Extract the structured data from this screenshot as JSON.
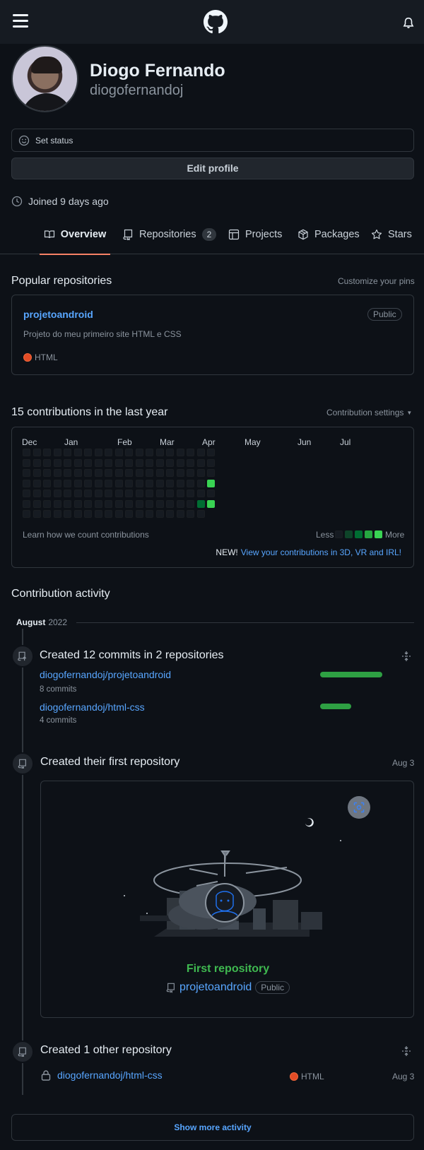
{
  "profile": {
    "full_name": "Diogo Fernando",
    "login": "diogofernandoj",
    "set_status": "Set status",
    "edit_profile": "Edit profile",
    "joined": "Joined 9 days ago"
  },
  "tabs": [
    {
      "label": "Overview",
      "icon": "book-icon",
      "active": true
    },
    {
      "label": "Repositories",
      "icon": "repo-icon",
      "count": "2"
    },
    {
      "label": "Projects",
      "icon": "table-icon"
    },
    {
      "label": "Packages",
      "icon": "package-icon"
    },
    {
      "label": "Stars",
      "icon": "star-icon"
    }
  ],
  "popular": {
    "title": "Popular repositories",
    "customize": "Customize your pins",
    "repo": {
      "name": "projetoandroid",
      "visibility": "Public",
      "description": "Projeto do meu primeiro site HTML e CSS",
      "language": "HTML",
      "language_color": "#e34c26"
    }
  },
  "contributions": {
    "title": "15 contributions in the last year",
    "settings": "Contribution settings",
    "months": [
      "Dec",
      "Jan",
      "Feb",
      "Mar",
      "Apr",
      "May",
      "Jun",
      "Jul"
    ],
    "learn": "Learn how we count contributions",
    "less": "Less",
    "more": "More",
    "new_label": "NEW!",
    "new_link": "View your contributions in 3D, VR and IRL!",
    "active_days": [
      {
        "week": 18,
        "day": 3,
        "level": 4
      },
      {
        "week": 17,
        "day": 5,
        "level": 2
      },
      {
        "week": 18,
        "day": 5,
        "level": 4
      }
    ]
  },
  "activity": {
    "title": "Contribution activity",
    "month": "August",
    "year": "2022",
    "commits": {
      "title": "Created 12 commits in 2 repositories",
      "repos": [
        {
          "name": "diogofernandoj/projetoandroid",
          "commits": "8 commits",
          "share": 1.0
        },
        {
          "name": "diogofernandoj/html-css",
          "commits": "4 commits",
          "share": 0.5
        }
      ]
    },
    "first_repo": {
      "title": "Created their first repository",
      "date": "Aug 3",
      "caption": "First repository",
      "repo": "projetoandroid",
      "visibility": "Public"
    },
    "other_repo": {
      "title": "Created 1 other repository",
      "repo": "diogofernandoj/html-css",
      "language": "HTML",
      "date": "Aug 3"
    },
    "show_more": "Show more activity"
  },
  "colors": {
    "background": "#0d1117",
    "link": "#58a6ff",
    "accent_underline": "#f78166",
    "green": "#2ea043"
  }
}
